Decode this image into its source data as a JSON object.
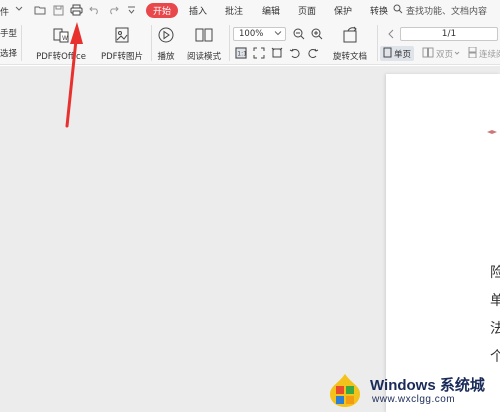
{
  "menubar": {
    "file_label": "件",
    "tabs": [
      "开始",
      "插入",
      "批注",
      "编辑",
      "页面",
      "保护",
      "转换"
    ],
    "search_placeholder": "查找功能、文档内容"
  },
  "ribbon": {
    "left_cut_top": "手型",
    "left_cut_bottom": "选择",
    "pdf_to_office": "PDF转Office",
    "pdf_to_image": "PDF转图片",
    "play": "播放",
    "read_mode": "阅读模式",
    "zoom": "100%",
    "rotate_doc": "旋转文档",
    "page_indicator": "1/1",
    "single_page": "单页",
    "double_page": "双页",
    "continuous": "连续阅"
  },
  "document": {
    "visible_chars": [
      "险",
      "单",
      "法",
      "个"
    ]
  },
  "watermark": {
    "title": "Windows 系统城",
    "url": "www.wxclgg.com"
  },
  "colors": {
    "accent": "#e8474b",
    "arrow": "#e8312f",
    "chrome": "#f7f7f7",
    "canvas": "#ececec"
  }
}
